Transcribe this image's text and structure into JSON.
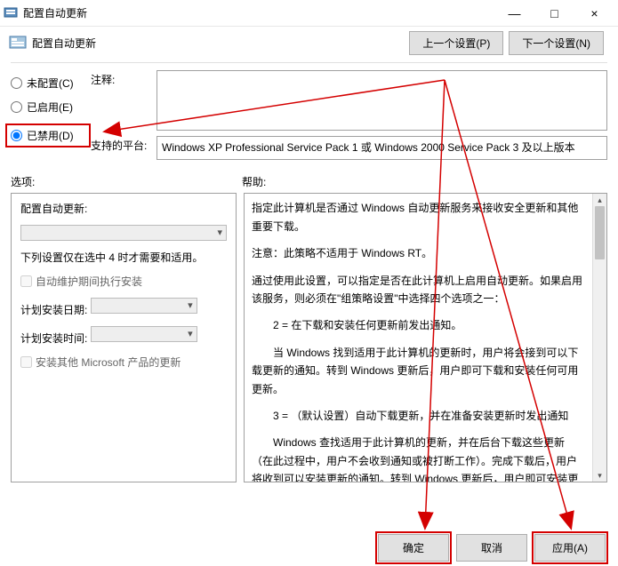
{
  "window": {
    "title": "配置自动更新",
    "minimize": "—",
    "maximize": "□",
    "close": "×"
  },
  "subheader": {
    "title": "配置自动更新",
    "prev_btn": "上一个设置(P)",
    "next_btn": "下一个设置(N)"
  },
  "radios": {
    "not_configured": "未配置(C)",
    "enabled": "已启用(E)",
    "disabled": "已禁用(D)"
  },
  "form": {
    "note_label": "注释:",
    "note_value": "",
    "platform_label": "支持的平台:",
    "platform_value": "Windows XP Professional Service Pack 1 或 Windows 2000 Service Pack 3 及以上版本"
  },
  "sections": {
    "options_label": "选项:",
    "help_label": "帮助:"
  },
  "options": {
    "configure_label": "配置自动更新:",
    "hint": "下列设置仅在选中 4 时才需要和适用。",
    "checkbox_maint": "自动维护期间执行安装",
    "schedule_day_label": "计划安装日期:",
    "schedule_time_label": "计划安装时间:",
    "checkbox_ms_products": "安装其他 Microsoft 产品的更新"
  },
  "help": {
    "p1": "指定此计算机是否通过 Windows 自动更新服务来接收安全更新和其他重要下载。",
    "p2": "注意：此策略不适用于 Windows RT。",
    "p3": "通过使用此设置，可以指定是否在此计算机上启用自动更新。如果启用该服务，则必须在\"组策略设置\"中选择四个选项之一：",
    "p4": "2 = 在下载和安装任何更新前发出通知。",
    "p5": "当 Windows 找到适用于此计算机的更新时，用户将会接到可以下载更新的通知。转到 Windows 更新后，用户即可下载和安装任何可用更新。",
    "p6": "3 = （默认设置）自动下载更新，并在准备安装更新时发出通知",
    "p7": "Windows 查找适用于此计算机的更新，并在后台下载这些更新（在此过程中，用户不会收到通知或被打断工作）。完成下载后，用户将收到可以安装更新的通知。转到 Windows 更新后，用户即可安装更新。"
  },
  "footer": {
    "ok": "确定",
    "cancel": "取消",
    "apply": "应用(A)"
  }
}
